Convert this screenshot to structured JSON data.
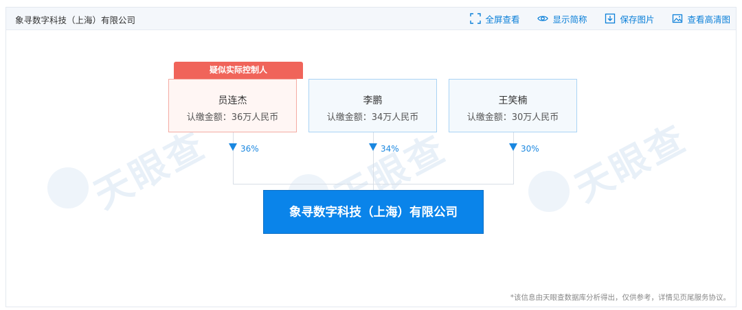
{
  "header": {
    "title": "象寻数字科技（上海）有限公司",
    "tools": [
      {
        "label": "全屏查看",
        "icon": "fullscreen-icon"
      },
      {
        "label": "显示简称",
        "icon": "eye-icon"
      },
      {
        "label": "保存图片",
        "icon": "download-icon"
      },
      {
        "label": "查看高清图",
        "icon": "image-icon"
      }
    ]
  },
  "watermark": {
    "text": "天眼查"
  },
  "tag": {
    "label": "疑似实际控制人"
  },
  "shareholders": [
    {
      "name": "员连杰",
      "amount": "认缴金额：36万人民币",
      "percent": "36%"
    },
    {
      "name": "李鹏",
      "amount": "认缴金额：34万人民币",
      "percent": "34%"
    },
    {
      "name": "王笑楠",
      "amount": "认缴金额：30万人民币",
      "percent": "30%"
    }
  ],
  "company": {
    "name": "象寻数字科技（上海）有限公司"
  },
  "footer": {
    "note": "*该信息由天眼查数据库分析得出，仅供参考，详情见页尾服务协议。"
  },
  "colors": {
    "accent": "#0a84ea",
    "highlight": "#f0645a",
    "link": "#0a7fd8"
  }
}
